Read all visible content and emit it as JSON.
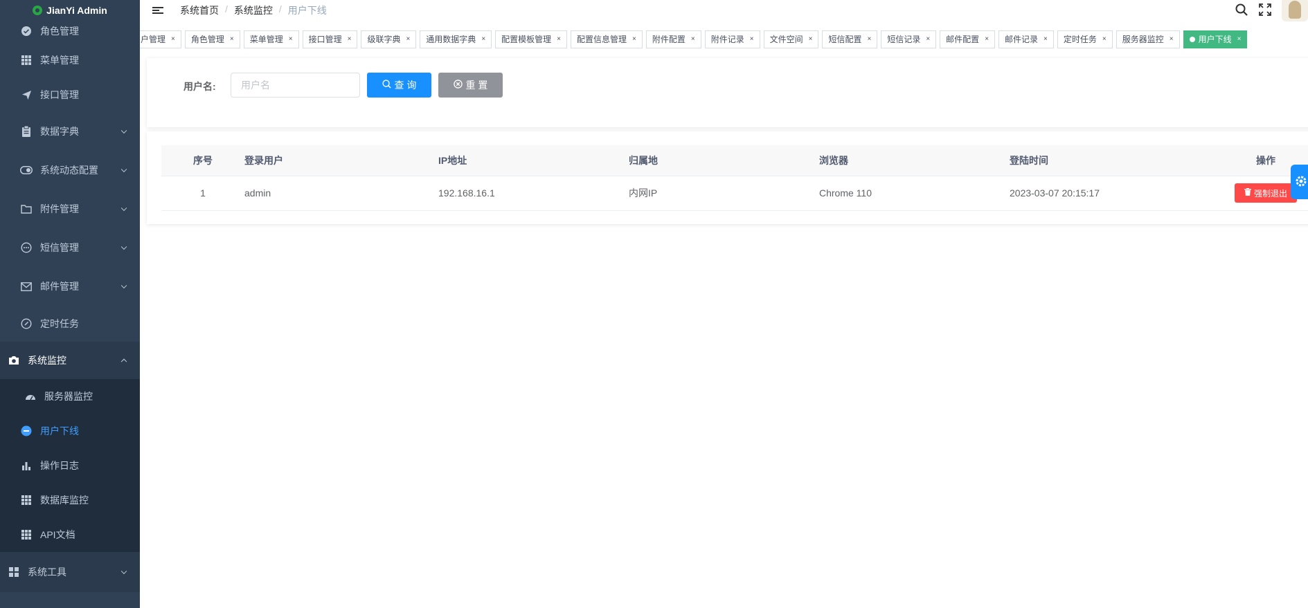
{
  "app": {
    "title": "JianYi Admin"
  },
  "sidebar": {
    "top_items": [
      {
        "label": "角色管理",
        "icon": "check-circle-icon"
      },
      {
        "label": "菜单管理",
        "icon": "grid-icon"
      },
      {
        "label": "接口管理",
        "icon": "send-icon"
      },
      {
        "label": "数据字典",
        "icon": "clipboard-icon"
      },
      {
        "label": "系统动态配置",
        "icon": "toggle-icon"
      },
      {
        "label": "附件管理",
        "icon": "folder-icon"
      },
      {
        "label": "短信管理",
        "icon": "chat-icon"
      },
      {
        "label": "邮件管理",
        "icon": "mail-icon"
      },
      {
        "label": "定时任务",
        "icon": "compass-icon"
      }
    ],
    "monitor_group": {
      "label": "系统监控",
      "icon": "camera-icon"
    },
    "monitor_items": [
      {
        "label": "服务器监控",
        "icon": "dashboard-icon"
      },
      {
        "label": "用户下线",
        "icon": "minus-circle-icon"
      },
      {
        "label": "操作日志",
        "icon": "bar-chart-icon"
      },
      {
        "label": "数据库监控",
        "icon": "grid-icon"
      },
      {
        "label": "API文档",
        "icon": "grid-icon"
      }
    ],
    "tools_group": {
      "label": "系统工具",
      "icon": "apps-icon"
    }
  },
  "breadcrumb": [
    "系统首页",
    "系统监控",
    "用户下线"
  ],
  "tags": [
    {
      "label": "户管理"
    },
    {
      "label": "角色管理"
    },
    {
      "label": "菜单管理"
    },
    {
      "label": "接口管理"
    },
    {
      "label": "级联字典"
    },
    {
      "label": "通用数据字典"
    },
    {
      "label": "配置模板管理"
    },
    {
      "label": "配置信息管理"
    },
    {
      "label": "附件配置"
    },
    {
      "label": "附件记录"
    },
    {
      "label": "文件空间"
    },
    {
      "label": "短信配置"
    },
    {
      "label": "短信记录"
    },
    {
      "label": "邮件配置"
    },
    {
      "label": "邮件记录"
    },
    {
      "label": "定时任务"
    },
    {
      "label": "服务器监控"
    },
    {
      "label": "用户下线",
      "active": true
    }
  ],
  "tag_close": "×",
  "search": {
    "label": "用户名:",
    "placeholder": "用户名",
    "query_label": "查 询",
    "reset_label": "重 置"
  },
  "table": {
    "columns": [
      "序号",
      "登录用户",
      "IP地址",
      "归属地",
      "浏览器",
      "登陆时间",
      "操作"
    ],
    "rows": [
      {
        "index": "1",
        "user": "admin",
        "ip": "192.168.16.1",
        "location": "内网IP",
        "browser": "Chrome 110",
        "time": "2023-03-07 20:15:17",
        "action": "强制退出"
      }
    ]
  },
  "colors": {
    "sidebar_bg": "#304156",
    "active": "#409eff",
    "primary": "#1890ff",
    "tag_active": "#42b983",
    "danger": "#ff4949"
  }
}
